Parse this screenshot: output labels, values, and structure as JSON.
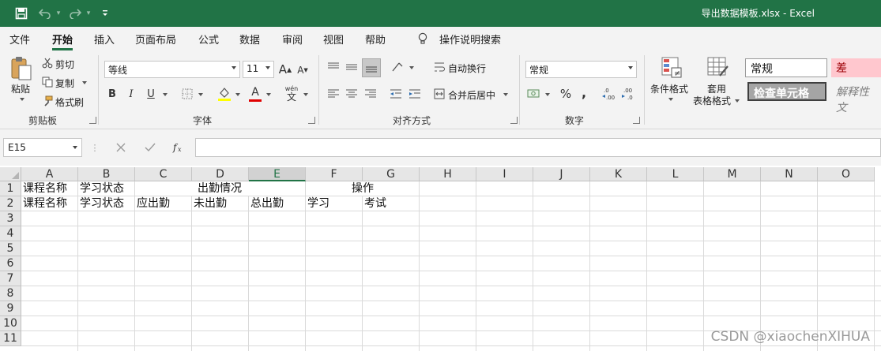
{
  "window": {
    "title": "导出数据模板.xlsx  -  Excel"
  },
  "menu": {
    "tabs": [
      "文件",
      "开始",
      "插入",
      "页面布局",
      "公式",
      "数据",
      "审阅",
      "视图",
      "帮助"
    ],
    "active_tab": "开始",
    "tell_me": "操作说明搜索"
  },
  "ribbon": {
    "clipboard": {
      "label": "剪贴板",
      "paste": "粘贴",
      "cut": "剪切",
      "copy": "复制",
      "format_painter": "格式刷"
    },
    "font": {
      "label": "字体",
      "font_name": "等线",
      "font_size": "11",
      "bold": "B",
      "italic": "I",
      "underline": "U",
      "grow": "A",
      "shrink": "A",
      "wen": "wén",
      "wen_char": "文",
      "font_color_letter": "A",
      "highlight_color": "#ffff00",
      "font_color": "#e00000"
    },
    "alignment": {
      "label": "对齐方式",
      "wrap_text": "自动换行",
      "merge_center": "合并后居中"
    },
    "number": {
      "label": "数字",
      "format": "常规",
      "percent": "%",
      "comma": ","
    },
    "styles": {
      "conditional_formatting": "条件格式",
      "format_as_table_1": "套用",
      "format_as_table_2": "表格格式",
      "normal": "常规",
      "bad": "差",
      "check_cell": "检查单元格",
      "explanatory": "解释性文"
    }
  },
  "formula_bar": {
    "name_box": "E15",
    "formula": ""
  },
  "sheet": {
    "columns": [
      "A",
      "B",
      "C",
      "D",
      "E",
      "F",
      "G",
      "H",
      "I",
      "J",
      "K",
      "L",
      "M",
      "N",
      "O"
    ],
    "selected_column": "E",
    "rows": [
      "1",
      "2",
      "3",
      "4",
      "5",
      "6",
      "7",
      "8",
      "9",
      "10",
      "11"
    ],
    "row1": {
      "A": "课程名称",
      "B": "学习状态",
      "D": "出勤情况",
      "F": "操作"
    },
    "row2": {
      "A": "课程名称",
      "B": "学习状态",
      "C": "应出勤",
      "D": "未出勤",
      "E": "总出勤",
      "F": "学习",
      "G": "考试"
    }
  },
  "watermark": "CSDN @xiaochenXIHUA"
}
